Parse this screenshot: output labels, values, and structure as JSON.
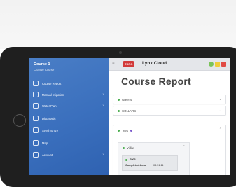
{
  "sidebar": {
    "title": "Course 1",
    "subtitle": "Change Course",
    "items": [
      {
        "label": "Course Report",
        "icon": "report-icon"
      },
      {
        "label": "Manual Irrigation",
        "icon": "irrigation-icon"
      },
      {
        "label": "Water Plan",
        "icon": "water-plan-icon"
      },
      {
        "label": "Diagnostic",
        "icon": "diagnostic-icon"
      },
      {
        "label": "Synchronize",
        "icon": "sync-icon"
      },
      {
        "label": "Map",
        "icon": "map-icon"
      },
      {
        "label": "Account",
        "icon": "account-icon"
      }
    ]
  },
  "appbar": {
    "badge": "TORO",
    "brand": "Lynx Cloud",
    "status_colors": [
      "#7bc35a",
      "#f0cc3a",
      "#e14b45"
    ]
  },
  "page": {
    "title": "Course Report",
    "cards": [
      {
        "label": "Greens",
        "chevron": "⌄"
      },
      {
        "label": "COLLARS",
        "chevron": "⌄"
      },
      {
        "label": "Tees",
        "chevron": "⌃"
      }
    ],
    "inner": {
      "label": "Villlas",
      "chevron": "⌃",
      "item": {
        "id": "T003",
        "key": "Completed Auto",
        "value": "08:51:11"
      }
    }
  }
}
